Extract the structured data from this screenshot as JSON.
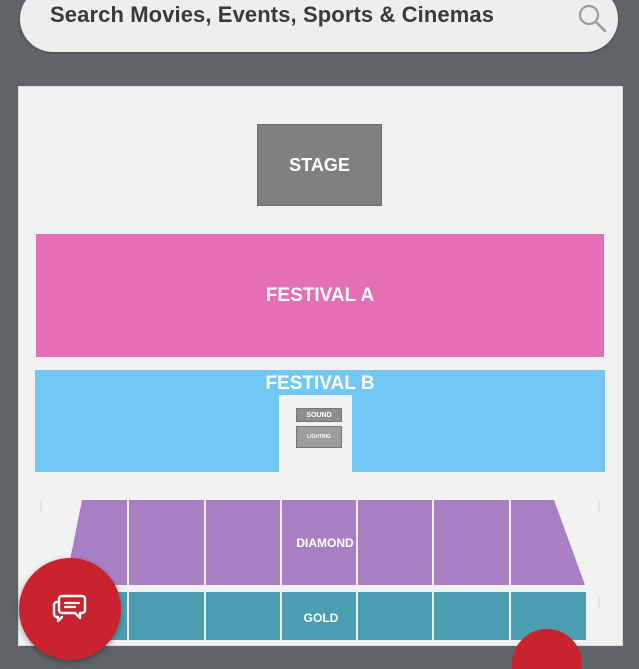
{
  "search": {
    "placeholder": "Search Movies, Events, Sports & Cinemas",
    "icon": "search-icon"
  },
  "seating_map": {
    "stage": "STAGE",
    "festival_a": "FESTIVAL A",
    "festival_b": "FESTIVAL B",
    "sound_booth": {
      "top": "SOUND",
      "bottom": "LIGHTING"
    },
    "diamond": "DIAMOND",
    "gold": "GOLD"
  },
  "chat": {
    "icon": "chat-bubbles-icon"
  },
  "colors": {
    "header": "#5f6469",
    "stage": "#808080",
    "festival_a": "#e66eb6",
    "festival_b": "#72c8f4",
    "diamond": "#a97fc4",
    "gold": "#4b9eb1",
    "accent_red": "#c8232f"
  }
}
